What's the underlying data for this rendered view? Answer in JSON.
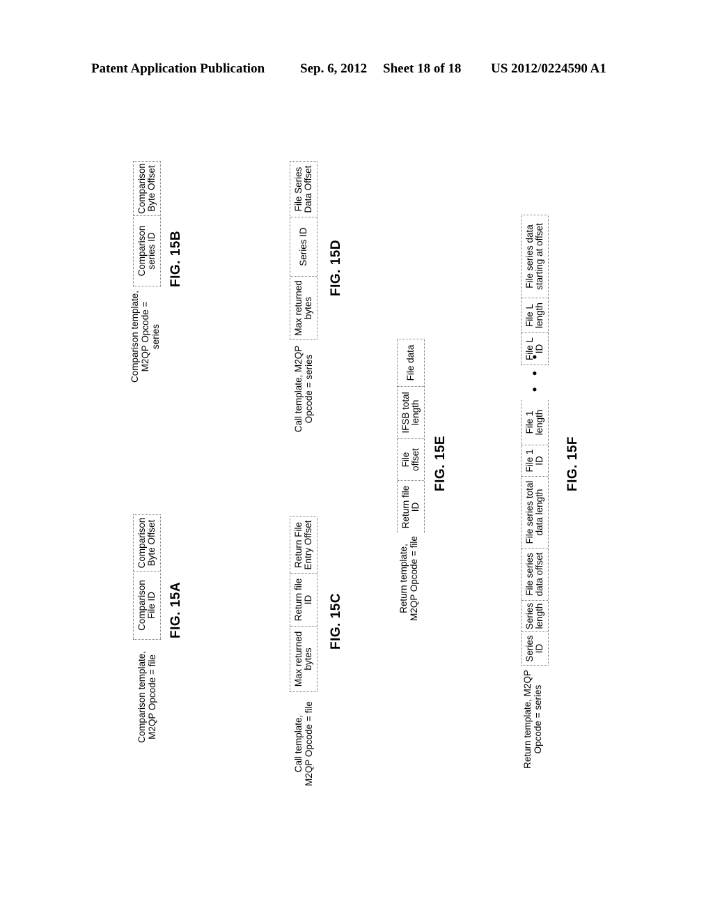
{
  "header": {
    "publication": "Patent Application Publication",
    "date": "Sep. 6, 2012",
    "sheet": "Sheet 18 of 18",
    "number": "US 2012/0224590 A1"
  },
  "figures": {
    "fig15a": {
      "label_line1": "Comparison template,",
      "label_line2": "M2QP Opcode = file",
      "cells": [
        [
          "Comparison",
          "File ID"
        ],
        [
          "Comparison",
          "Byte Offset"
        ]
      ],
      "caption": "FIG. 15A"
    },
    "fig15b": {
      "label_line1": "Comparison template,",
      "label_line2": "M2QP Opcode =",
      "label_line3": "series",
      "cells": [
        [
          "Comparison",
          "series ID"
        ],
        [
          "Comparison",
          "Byte Offset"
        ]
      ],
      "caption": "FIG. 15B"
    },
    "fig15c": {
      "label_line1": "Call template,",
      "label_line2": "M2QP Opcode = file",
      "cells": [
        [
          "Max returned",
          "bytes"
        ],
        [
          "Return file",
          "ID"
        ],
        [
          "Return File",
          "Entry Offset"
        ]
      ],
      "caption": "FIG. 15C"
    },
    "fig15d": {
      "label_line1": "Call template, M2QP",
      "label_line2": "Opcode = series",
      "cells": [
        [
          "Max returned",
          "bytes"
        ],
        [
          "Series ID",
          ""
        ],
        [
          "File Series",
          "Data Offset"
        ]
      ],
      "caption": "FIG. 15D"
    },
    "fig15e": {
      "label_line1": "Return template,",
      "label_line2": "M2QP Opcode = file",
      "cells": [
        [
          "Return file",
          "ID"
        ],
        [
          "File",
          "offset"
        ],
        [
          "IFSB total",
          "length"
        ],
        [
          "File data",
          ""
        ]
      ],
      "caption": "FIG. 15E"
    },
    "fig15f": {
      "label_line1": "Return template, M2QP",
      "label_line2": "Opcode = series",
      "cells_part1": [
        [
          "Series",
          "ID"
        ],
        [
          "Series",
          "length"
        ],
        [
          "File series",
          "data offset"
        ],
        [
          "File series total",
          "data length"
        ],
        [
          "File 1",
          "ID"
        ],
        [
          "File 1",
          "length"
        ]
      ],
      "ellipsis": "• • •",
      "cells_part2": [
        [
          "File L",
          "ID"
        ],
        [
          "File L",
          "length"
        ],
        [
          "File series data",
          "starting at offset"
        ]
      ],
      "caption": "FIG. 15F"
    }
  }
}
